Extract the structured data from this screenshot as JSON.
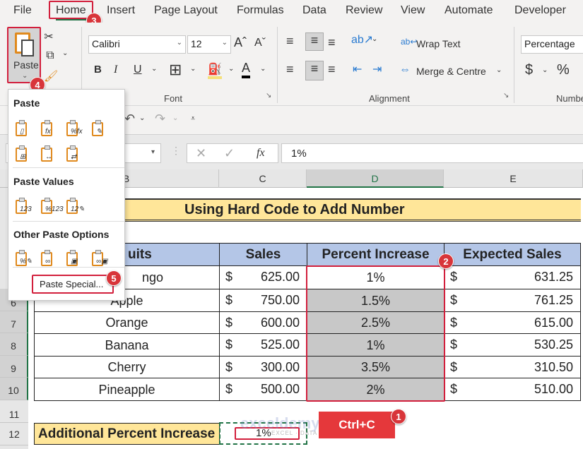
{
  "ribbon_tabs": [
    "File",
    "Home",
    "Insert",
    "Page Layout",
    "Formulas",
    "Data",
    "Review",
    "View",
    "Automate",
    "Developer"
  ],
  "active_tab": "Home",
  "clipboard": {
    "paste_label": "Paste"
  },
  "font": {
    "name": "Calibri",
    "size": "12",
    "group_label": "Font",
    "bold": "B",
    "italic": "I",
    "underline": "U"
  },
  "alignment": {
    "wrap_text": "Wrap Text",
    "merge_centre": "Merge & Centre",
    "group_label": "Alignment"
  },
  "number": {
    "format": "Percentage",
    "currency": "$",
    "percent": "%",
    "group_label": "Numbe"
  },
  "formula_bar": {
    "fx": "fx",
    "value": "1%"
  },
  "columns": [
    "B",
    "C",
    "D",
    "E"
  ],
  "rows": [
    "6",
    "7",
    "8",
    "9",
    "10",
    "11",
    "12"
  ],
  "sheet": {
    "title": "Using Hard Code to Add Number",
    "headers": [
      "Fruits",
      "Sales",
      "Percent Increase",
      "Expected Sales"
    ],
    "header_visible_first": "uits",
    "data": [
      {
        "fruit": "Mango",
        "fruit_visible": "ngo",
        "sales": "625.00",
        "pct": "1%",
        "expected": "631.25"
      },
      {
        "fruit": "Apple",
        "sales": "750.00",
        "pct": "1.5%",
        "expected": "761.25"
      },
      {
        "fruit": "Orange",
        "sales": "600.00",
        "pct": "2.5%",
        "expected": "615.00"
      },
      {
        "fruit": "Banana",
        "sales": "525.00",
        "pct": "1%",
        "expected": "530.25"
      },
      {
        "fruit": "Cherry",
        "sales": "300.00",
        "pct": "3.5%",
        "expected": "310.50"
      },
      {
        "fruit": "Pineapple",
        "sales": "500.00",
        "pct": "2%",
        "expected": "510.00"
      }
    ],
    "currency_symbol": "$",
    "additional_label": "Additional Percent Increase",
    "additional_value": "1%"
  },
  "paste_menu": {
    "section_paste": "Paste",
    "section_values": "Paste Values",
    "section_other": "Other Paste Options",
    "paste_special": "Paste Special...",
    "paste_icons": [
      "paste",
      "formulas",
      "formulas-number-formatting",
      "keep-source-formatting",
      "no-borders",
      "keep-column-widths",
      "transpose"
    ],
    "value_icons": [
      "values",
      "values-number-formatting",
      "values-source-formatting"
    ],
    "other_icons": [
      "formatting",
      "paste-link",
      "picture",
      "linked-picture"
    ]
  },
  "callouts": {
    "ctrl_c": "Ctrl+C",
    "steps": [
      "1",
      "2",
      "3",
      "4",
      "5"
    ]
  },
  "watermark": {
    "brand": "exceldemy",
    "tagline": "EXCEL · DATA · BI"
  },
  "colors": {
    "accent_red": "#d21f3c",
    "title_fill": "#ffe699",
    "header_fill": "#b4c6e7",
    "selected_fill": "#c8c8c8",
    "excel_green": "#217346"
  }
}
